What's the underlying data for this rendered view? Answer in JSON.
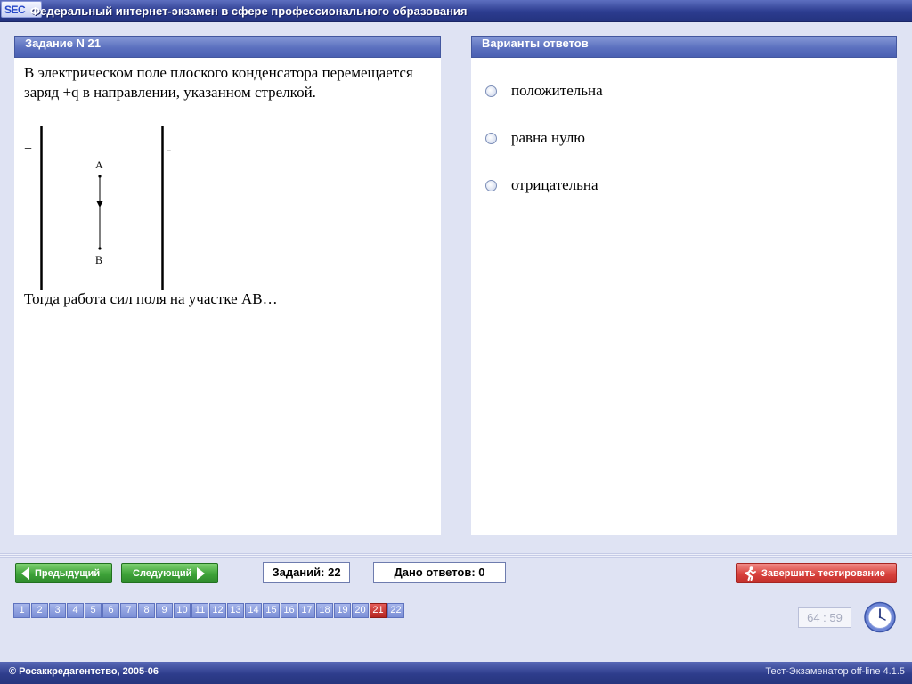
{
  "app": {
    "logo_text": "SEC",
    "title": "Федеральный интернет-экзамен в сфере профессионального образования"
  },
  "task": {
    "header": "Задание N 21",
    "question_part1": "В электрическом поле плоского конденсатора перемещается заряд +q в направлении, указанном стрелкой.",
    "diagram": {
      "plus_sign": "+",
      "minus_sign": "-",
      "point_a": "A",
      "point_b": "B"
    },
    "question_part2": "Тогда работа сил поля на участке АВ…"
  },
  "answers": {
    "header": "Варианты ответов",
    "options": [
      {
        "label": "положительна"
      },
      {
        "label": "равна нулю"
      },
      {
        "label": "отрицательна"
      }
    ]
  },
  "controls": {
    "prev_label": "Предыдущий",
    "next_label": "Следующий",
    "tasks_count": "Заданий: 22",
    "answers_given": "Дано ответов: 0",
    "finish_label": "Завершить тестирование"
  },
  "navigation": {
    "questions": [
      "1",
      "2",
      "3",
      "4",
      "5",
      "6",
      "7",
      "8",
      "9",
      "10",
      "11",
      "12",
      "13",
      "14",
      "15",
      "16",
      "17",
      "18",
      "19",
      "20",
      "21",
      "22"
    ],
    "current": "21"
  },
  "timer": {
    "value": "64 : 59"
  },
  "footer": {
    "copyright": "© Росаккредагентство, 2005-06",
    "version": "Тест-Экзаменатор off-line 4.1.5"
  },
  "colors": {
    "accent": "#2c3c8f",
    "next_button": "#3ea339",
    "finish_button": "#d9423d",
    "current_question": "#b52621",
    "question_button": "#7b8fd6"
  }
}
